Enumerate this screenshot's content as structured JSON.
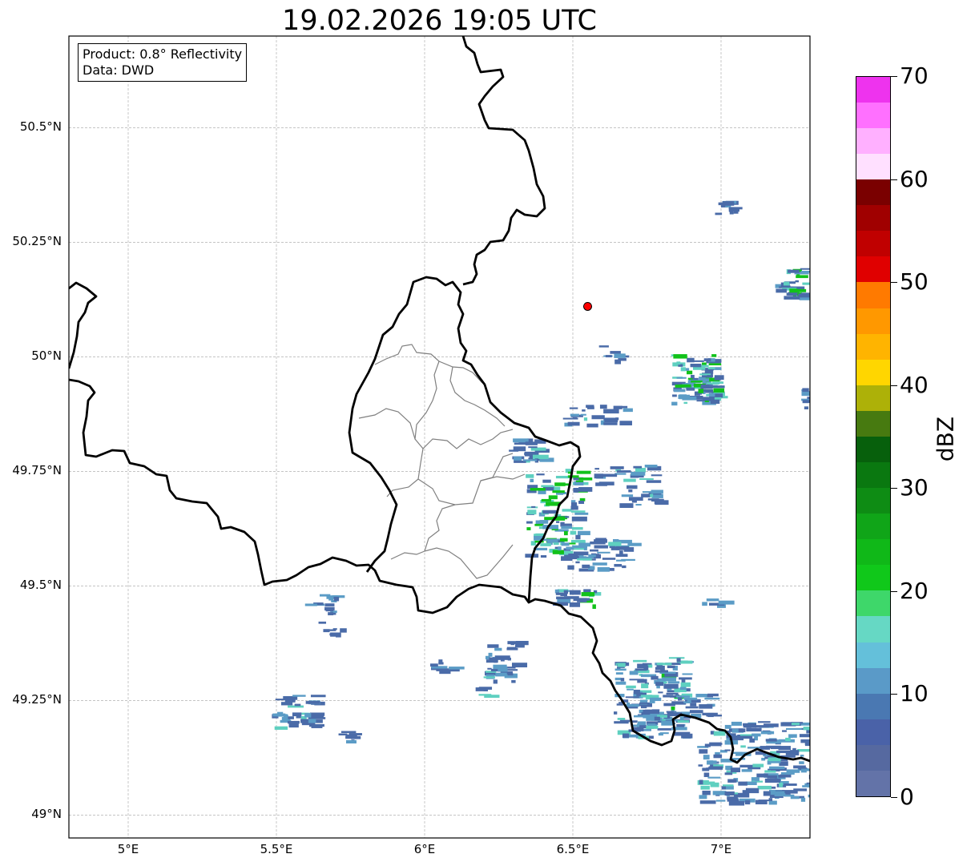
{
  "title": "19.02.2026 19:05 UTC",
  "info": {
    "product": "Product: 0.8° Reflectivity",
    "source": "Data: DWD"
  },
  "map": {
    "lon_range": [
      4.8,
      7.3
    ],
    "lat_range": [
      48.95,
      50.7
    ],
    "lat_ticks": [
      {
        "value": 50.5,
        "label": "50.5°N"
      },
      {
        "value": 50.25,
        "label": "50.25°N"
      },
      {
        "value": 50.0,
        "label": "50°N"
      },
      {
        "value": 49.75,
        "label": "49.75°N"
      },
      {
        "value": 49.5,
        "label": "49.5°N"
      },
      {
        "value": 49.25,
        "label": "49.25°N"
      },
      {
        "value": 49.0,
        "label": "49°N"
      }
    ],
    "lon_ticks": [
      {
        "value": 5.0,
        "label": "5°E"
      },
      {
        "value": 5.5,
        "label": "5.5°E"
      },
      {
        "value": 6.0,
        "label": "6°E"
      },
      {
        "value": 6.5,
        "label": "6.5°E"
      },
      {
        "value": 7.0,
        "label": "7°E"
      }
    ],
    "gridlines": true,
    "marker": {
      "lon": 6.55,
      "lat": 50.11,
      "color": "#ff0000"
    },
    "border_color": "#000000",
    "subdivision_color": "#808080",
    "echo_colors": {
      "weak": "#4a6ba8",
      "light": "#5b9cc6",
      "moderate": "#5fd0c0",
      "green": "#12c21a"
    }
  },
  "colorbar": {
    "label": "dBZ",
    "min": 0,
    "max": 70,
    "step": 2.5,
    "ticks": [
      {
        "value": 0,
        "label": "0"
      },
      {
        "value": 10,
        "label": "10"
      },
      {
        "value": 20,
        "label": "20"
      },
      {
        "value": 30,
        "label": "30"
      },
      {
        "value": 40,
        "label": "40"
      },
      {
        "value": 50,
        "label": "50"
      },
      {
        "value": 60,
        "label": "60"
      },
      {
        "value": 70,
        "label": "70"
      }
    ],
    "colors": [
      "#6373a8",
      "#5669a0",
      "#4a62a8",
      "#4a78b2",
      "#5a9ac8",
      "#64c0da",
      "#66d8c4",
      "#3ed76a",
      "#10c81a",
      "#10b818",
      "#10a518",
      "#0e8c14",
      "#0a7810",
      "#07600c",
      "#477a10",
      "#adb108",
      "#ffd600",
      "#ffb400",
      "#ff9800",
      "#ff7a00",
      "#e00000",
      "#c00000",
      "#a00000",
      "#7a0000",
      "#ffe0ff",
      "#ffb0ff",
      "#ff70ff",
      "#ee33ee"
    ]
  }
}
